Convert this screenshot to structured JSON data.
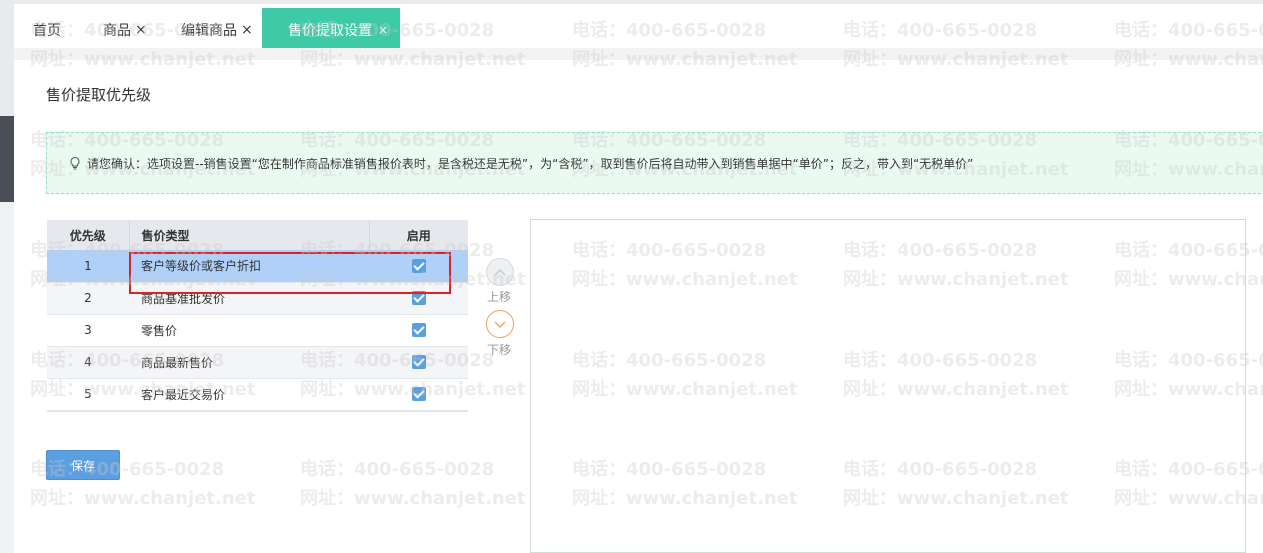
{
  "tabs": [
    {
      "label": "首页",
      "closable": false,
      "active": false
    },
    {
      "label": "商品",
      "closable": true,
      "active": false
    },
    {
      "label": "编辑商品",
      "closable": true,
      "active": false
    },
    {
      "label": "售价提取设置",
      "closable": true,
      "active": true
    }
  ],
  "close_glyph": "×",
  "page_title": "售价提取优先级",
  "notice": {
    "icon": "lightbulb-icon",
    "text": "请您确认：选项设置--销售设置“您在制作商品标准销售报价表时，是含税还是无税”，为“含税”，取到售价后将自动带入到销售单据中“单价”；反之，带入到“无税单价”"
  },
  "table": {
    "headers": [
      "优先级",
      "售价类型",
      "启用"
    ],
    "rows": [
      {
        "priority": "1",
        "type": "客户等级价或客户折扣",
        "enabled": true,
        "selected": true
      },
      {
        "priority": "2",
        "type": "商品基准批发价",
        "enabled": true,
        "selected": false
      },
      {
        "priority": "3",
        "type": "零售价",
        "enabled": true,
        "selected": false
      },
      {
        "priority": "4",
        "type": "商品最新售价",
        "enabled": true,
        "selected": false
      },
      {
        "priority": "5",
        "type": "客户最近交易价",
        "enabled": true,
        "selected": false
      }
    ]
  },
  "move": {
    "up_label": "上移",
    "down_label": "下移"
  },
  "save_label": "保存",
  "watermark": {
    "line1": "电话：400-665-0028",
    "line2": "网址：www.chanjet.net"
  },
  "colors": {
    "tab_active": "#3ec9a7",
    "selected_row": "#aed0f9",
    "highlight": "#d8232a",
    "button": "#5b9fe0",
    "down_accent": "#f0a35a"
  }
}
